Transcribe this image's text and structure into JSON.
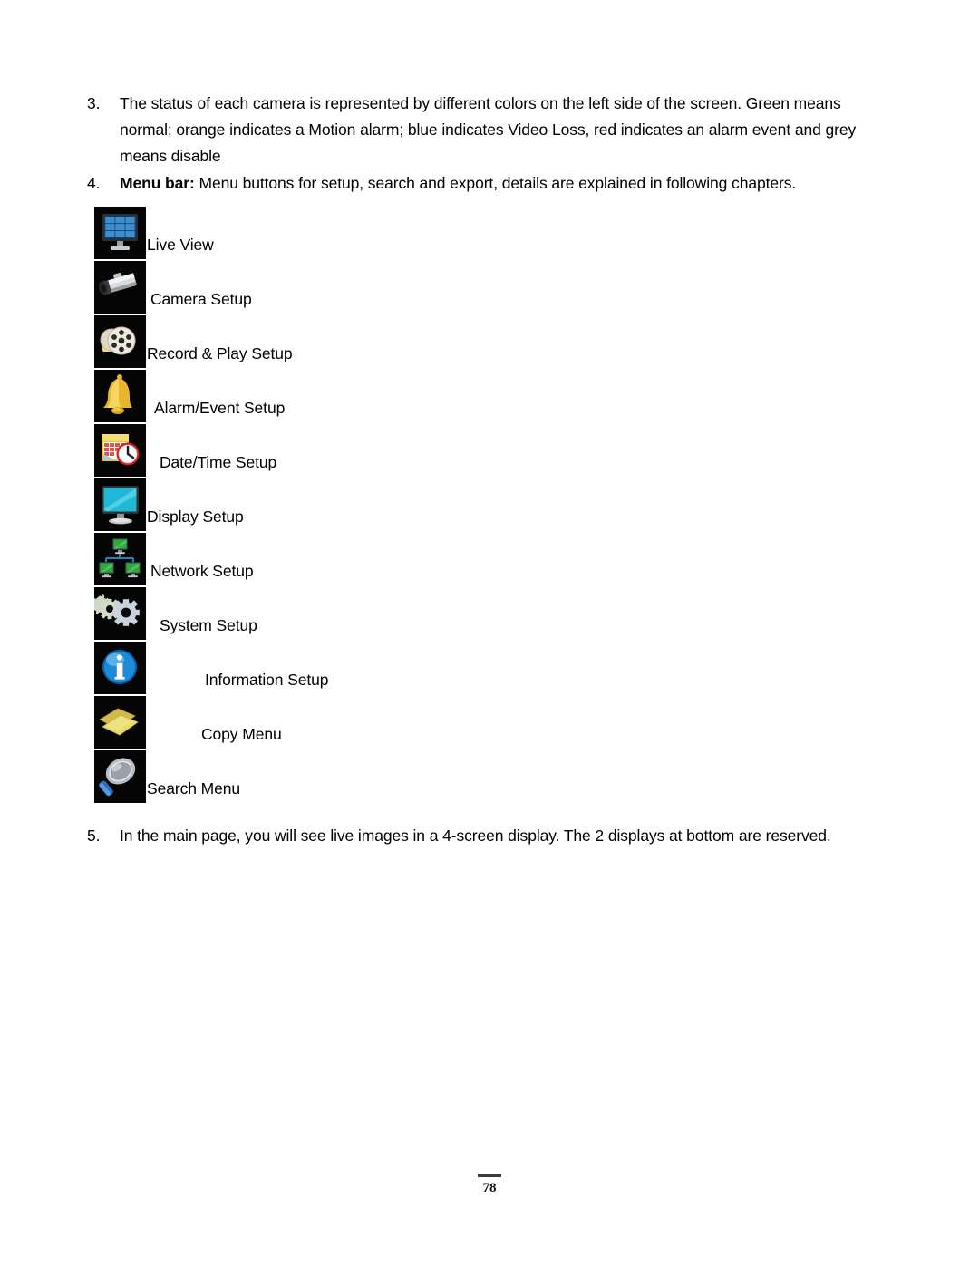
{
  "document": {
    "page_number": "78"
  },
  "paragraphs": [
    {
      "number": "3.",
      "lead": "",
      "text": "The status of each camera is represented by different colors on the left side of the screen. Green means normal; orange indicates a Motion alarm; blue indicates Video Loss, red indicates an alarm event and grey means disable"
    },
    {
      "number": "4.",
      "lead": "Menu bar:",
      "text": " Menu buttons for setup, search and export, details are explained in following chapters."
    }
  ],
  "menu_items": [
    {
      "label": "Live View",
      "icon": "live-view-monitor-grid-icon"
    },
    {
      "label": "Camera Setup",
      "icon": "box-camera-icon"
    },
    {
      "label": "Record & Play Setup",
      "icon": "film-reel-icon"
    },
    {
      "label": "Alarm/Event Setup",
      "icon": "bell-icon"
    },
    {
      "label": "Date/Time Setup",
      "icon": "calendar-clock-icon"
    },
    {
      "label": "Display Setup",
      "icon": "monitor-icon"
    },
    {
      "label": "Network Setup",
      "icon": "network-monitors-icon"
    },
    {
      "label": "System Setup",
      "icon": "gears-icon"
    },
    {
      "label": "Information Setup",
      "icon": "info-circle-icon"
    },
    {
      "label": "Copy Menu",
      "icon": "copy-sheets-icon"
    },
    {
      "label": "Search Menu",
      "icon": "magnifier-icon"
    }
  ],
  "closing_paragraph": {
    "number": "5.",
    "text": "In the main page, you will see live images in a 4-screen display. The 2 displays at bottom are reserved."
  }
}
